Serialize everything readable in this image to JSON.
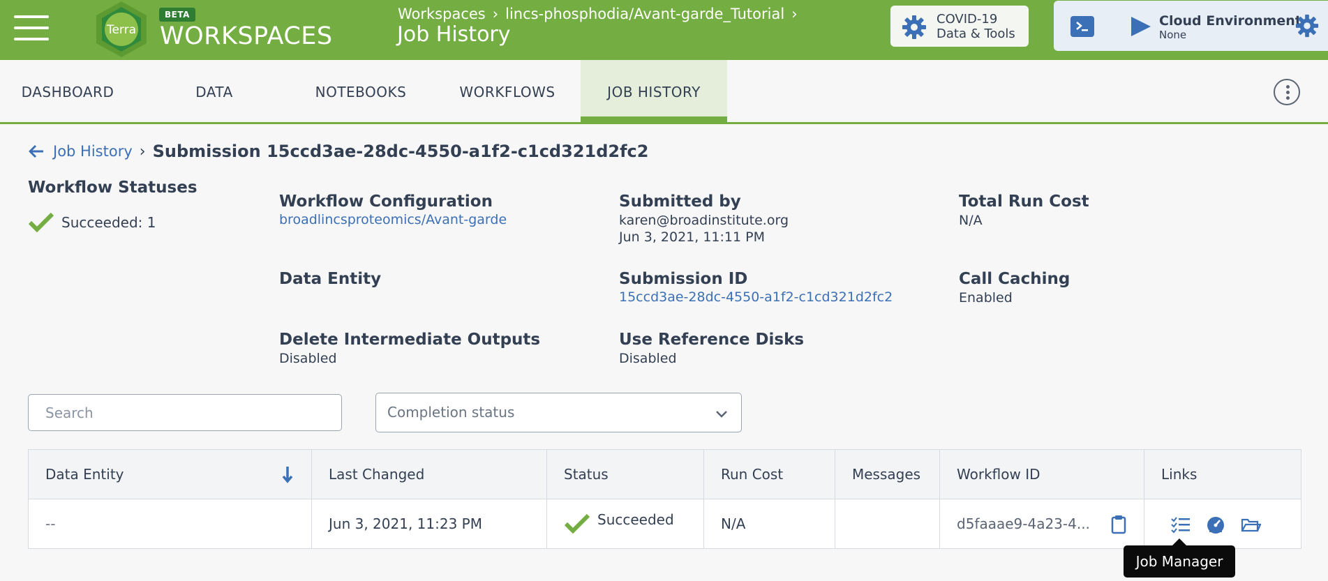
{
  "header": {
    "beta": "BETA",
    "brand": "WORKSPACES",
    "breadcrumb": [
      "Workspaces",
      "lincs-phosphodia/Avant-garde_Tutorial"
    ],
    "title": "Job History",
    "covid_line1": "COVID-19",
    "covid_line2": "Data & Tools",
    "cloud_title": "Cloud Environment",
    "cloud_status": "None",
    "logo_text": "Terra"
  },
  "tabs": [
    "DASHBOARD",
    "DATA",
    "NOTEBOOKS",
    "WORKFLOWS",
    "JOB HISTORY"
  ],
  "breadcrumb": {
    "parent": "Job History",
    "current": "Submission 15ccd3ae-28dc-4550-a1f2-c1cd321d2fc2"
  },
  "workflow_statuses": {
    "title": "Workflow Statuses",
    "succeeded": "Succeeded: 1"
  },
  "fields": {
    "workflow_configuration": {
      "label": "Workflow Configuration",
      "value": "broadlincsproteomics/Avant-garde"
    },
    "submitted_by": {
      "label": "Submitted by",
      "email": "karen@broadinstitute.org",
      "date": "Jun 3, 2021, 11:11 PM"
    },
    "total_run_cost": {
      "label": "Total Run Cost",
      "value": "N/A"
    },
    "data_entity": {
      "label": "Data Entity"
    },
    "submission_id": {
      "label": "Submission ID",
      "value": "15ccd3ae-28dc-4550-a1f2-c1cd321d2fc2"
    },
    "call_caching": {
      "label": "Call Caching",
      "value": "Enabled"
    },
    "delete_intermediate": {
      "label": "Delete Intermediate Outputs",
      "value": "Disabled"
    },
    "use_reference_disks": {
      "label": "Use Reference Disks",
      "value": "Disabled"
    }
  },
  "filters": {
    "search_placeholder": "Search",
    "status_placeholder": "Completion status"
  },
  "table": {
    "columns": [
      "Data Entity",
      "Last Changed",
      "Status",
      "Run Cost",
      "Messages",
      "Workflow ID",
      "Links"
    ],
    "rows": [
      {
        "data_entity": "--",
        "last_changed": "Jun 3, 2021, 11:23 PM",
        "status": "Succeeded",
        "run_cost": "N/A",
        "messages": "",
        "workflow_id": "d5faaae9-4a23-4..."
      }
    ]
  },
  "tooltip": "Job Manager",
  "colors": {
    "brand_green": "#74ae43",
    "link_blue": "#3b6fb6",
    "text": "#333f52"
  }
}
